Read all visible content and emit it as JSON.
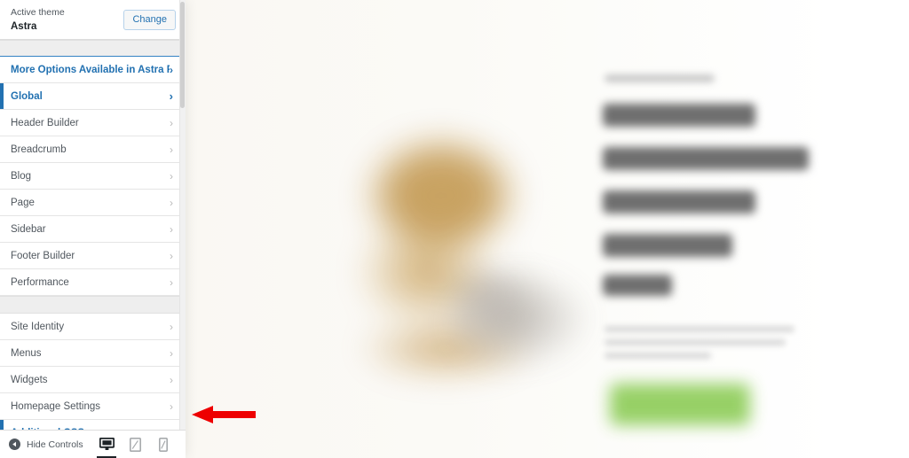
{
  "sidebar": {
    "theme": {
      "label": "Active theme",
      "name": "Astra",
      "change_label": "Change"
    },
    "pro_promo": {
      "label": "More Options Available in Astra Pro!",
      "chevron": "›"
    },
    "groups": [
      {
        "items": [
          {
            "label": "Global",
            "chevron": "›",
            "state": "active"
          },
          {
            "label": "Header Builder",
            "chevron": "›",
            "state": "normal"
          },
          {
            "label": "Breadcrumb",
            "chevron": "›",
            "state": "normal"
          },
          {
            "label": "Blog",
            "chevron": "›",
            "state": "normal"
          },
          {
            "label": "Page",
            "chevron": "›",
            "state": "normal"
          },
          {
            "label": "Sidebar",
            "chevron": "›",
            "state": "normal"
          },
          {
            "label": "Footer Builder",
            "chevron": "›",
            "state": "normal"
          },
          {
            "label": "Performance",
            "chevron": "›",
            "state": "normal"
          }
        ]
      },
      {
        "items": [
          {
            "label": "Site Identity",
            "chevron": "›",
            "state": "normal"
          },
          {
            "label": "Menus",
            "chevron": "›",
            "state": "normal"
          },
          {
            "label": "Widgets",
            "chevron": "›",
            "state": "normal"
          },
          {
            "label": "Homepage Settings",
            "chevron": "›",
            "state": "normal"
          },
          {
            "label": "Additional CSS",
            "chevron": "›",
            "state": "active"
          }
        ]
      }
    ],
    "footer": {
      "hide_controls_label": "Hide Controls",
      "devices": [
        {
          "name": "desktop",
          "active": true
        },
        {
          "name": "tablet",
          "active": false
        },
        {
          "name": "mobile",
          "active": false
        }
      ]
    }
  },
  "preview": {
    "description": "Blurred live site preview",
    "cta_color": "#8ccc56",
    "image_color": "#c49b56",
    "background_color": "#faf8f3"
  },
  "annotation": {
    "arrow_color": "#ee0000",
    "arrow_direction": "left",
    "points_to": "Additional CSS"
  },
  "colors": {
    "accent_blue": "#2271b1",
    "text_gray": "#50575e",
    "divider": "#e5e5e5"
  }
}
